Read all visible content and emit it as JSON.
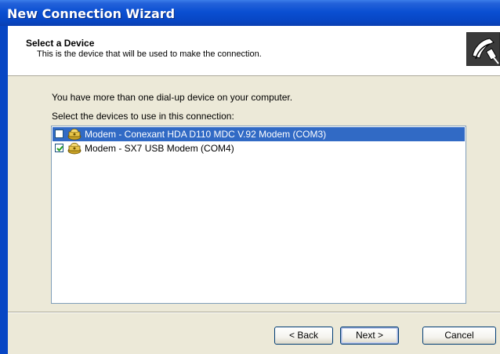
{
  "window": {
    "title": "New Connection Wizard"
  },
  "header": {
    "title": "Select a Device",
    "subtitle": "This is the device that will be used to make the connection.",
    "icon": "phone-connection-icon"
  },
  "body": {
    "intro": "You have more than one dial-up device on your computer.",
    "instruction": "Select the devices to use in this connection:"
  },
  "devices": [
    {
      "label": "Modem - Conexant HDA D110 MDC V.92 Modem (COM3)",
      "checked": false,
      "selected": true,
      "icon": "modem-icon"
    },
    {
      "label": "Modem - SX7 USB Modem (COM4)",
      "checked": true,
      "selected": false,
      "icon": "modem-icon"
    }
  ],
  "buttons": {
    "back": "< Back",
    "next": "Next >",
    "cancel": "Cancel"
  },
  "colors": {
    "titlebar": "#0a4fd2",
    "selection": "#316ac5",
    "face": "#ece9d8"
  }
}
